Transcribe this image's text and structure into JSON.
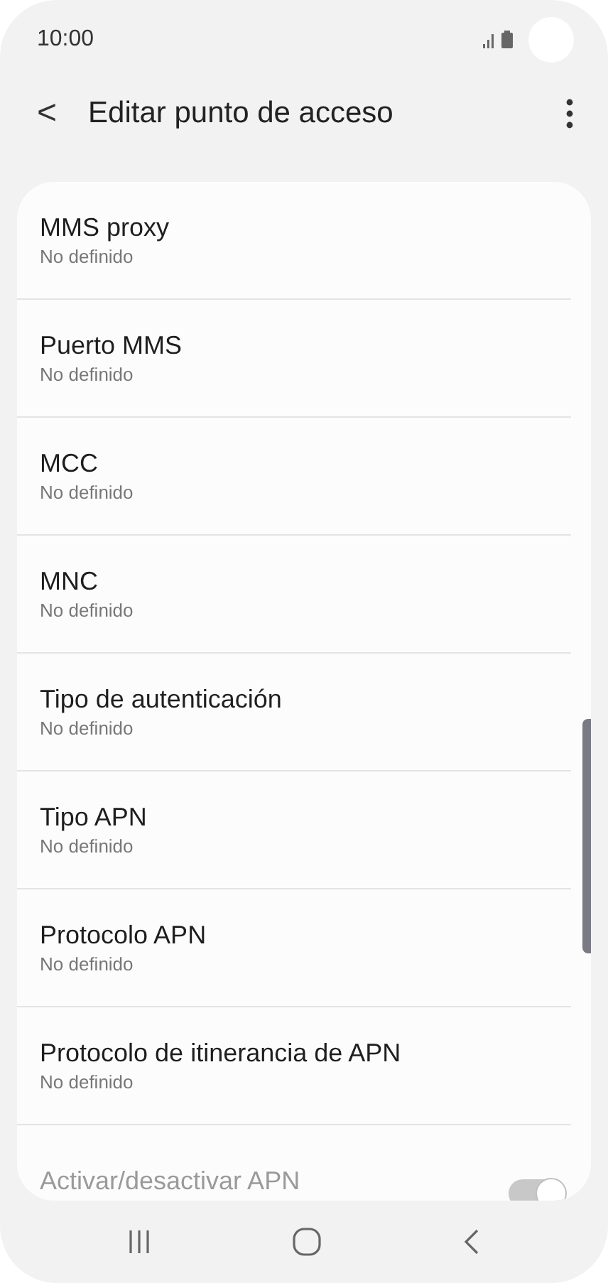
{
  "status_bar": {
    "time": "10:00"
  },
  "header": {
    "back": "<",
    "title": "Editar punto de acceso"
  },
  "settings": [
    {
      "kind": "text",
      "title": "MMS proxy",
      "value": "No definido",
      "disabled": false
    },
    {
      "kind": "text",
      "title": "Puerto MMS",
      "value": "No definido",
      "disabled": false
    },
    {
      "kind": "text",
      "title": "MCC",
      "value": "No definido",
      "disabled": false
    },
    {
      "kind": "text",
      "title": "MNC",
      "value": "No definido",
      "disabled": false
    },
    {
      "kind": "text",
      "title": "Tipo de autenticación",
      "value": "No definido",
      "disabled": false
    },
    {
      "kind": "text",
      "title": "Tipo APN",
      "value": "No definido",
      "disabled": false
    },
    {
      "kind": "text",
      "title": "Protocolo APN",
      "value": "No definido",
      "disabled": false
    },
    {
      "kind": "text",
      "title": "Protocolo de itinerancia de APN",
      "value": "No definido",
      "disabled": false
    },
    {
      "kind": "toggle",
      "title": "Activar/desactivar APN",
      "on": true,
      "disabled": true
    }
  ]
}
